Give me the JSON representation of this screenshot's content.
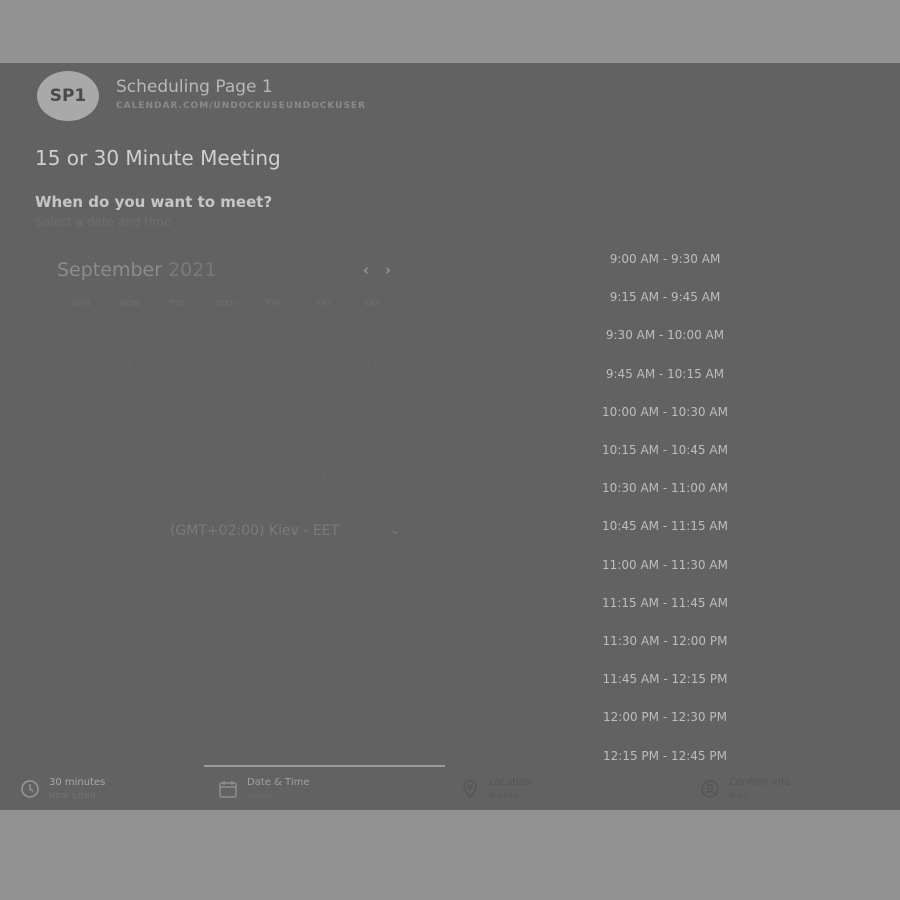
{
  "header": {
    "avatar_initials": "SP1",
    "title": "Scheduling Page 1",
    "url": "CALENDAR.COM/UNDOCKUSEUNDOCKUSER"
  },
  "meeting": {
    "title": "15 or 30 Minute Meeting",
    "question": "When do you want to meet?",
    "question_sub": "Select a date and time"
  },
  "calendar": {
    "month": "September",
    "year": "2021",
    "prev_icon": "chevron-left-icon",
    "next_icon": "chevron-right-icon",
    "days_of_week": [
      "SUN",
      "MON",
      "TUE",
      "WED",
      "THU",
      "FRI",
      "SAT"
    ],
    "weeks": [
      [
        "29",
        "30",
        "31",
        "1",
        "2",
        "3",
        "4"
      ],
      [
        "5",
        "6",
        "7",
        "8",
        "9",
        "10",
        "11"
      ],
      [
        "12",
        "13",
        "14",
        "15",
        "16",
        "17",
        "18"
      ],
      [
        "19",
        "20",
        "21",
        "22",
        "23",
        "24",
        "25"
      ],
      [
        "26",
        "27",
        "28",
        "29",
        "30",
        "1",
        "2"
      ]
    ]
  },
  "timezone": {
    "value": "(GMT+02:00) Kiev - EET",
    "caret_icon": "chevron-down-icon"
  },
  "time_slots": [
    "9:00 AM - 9:30 AM",
    "9:15 AM - 9:45 AM",
    "9:30 AM - 10:00 AM",
    "9:45 AM - 10:15 AM",
    "10:00 AM - 10:30 AM",
    "10:15 AM - 10:45 AM",
    "10:30 AM - 11:00 AM",
    "10:45 AM - 11:15 AM",
    "11:00 AM - 11:30 AM",
    "11:15 AM - 11:45 AM",
    "11:30 AM - 12:00 PM",
    "11:45 AM - 12:15 PM",
    "12:00 PM - 12:30 PM",
    "12:15 PM - 12:45 PM"
  ],
  "steps": [
    {
      "label": "30 minutes",
      "sub": "HOW LONG",
      "icon": "clock-icon"
    },
    {
      "label": "Date & Time",
      "sub": "WHEN",
      "icon": "calendar-icon"
    },
    {
      "label": "Location",
      "sub": "WHERE",
      "icon": "location-pin-icon"
    },
    {
      "label": "Confirm Info",
      "sub": "WHO",
      "icon": "person-icon"
    }
  ]
}
